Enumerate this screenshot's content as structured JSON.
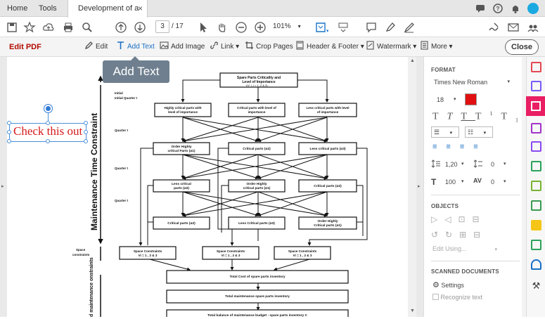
{
  "tabs": {
    "home": "Home",
    "tools": "Tools",
    "document": "Development of a s...",
    "close": "×"
  },
  "toolbar": {
    "page_current": "3",
    "page_total": "/ 17",
    "zoom": "101%"
  },
  "editbar": {
    "title": "Edit PDF",
    "edit": "Edit",
    "add_text": "Add Text",
    "add_image": "Add Image",
    "link": "Link ▾",
    "crop_pages": "Crop Pages",
    "header_footer": "Header & Footer ▾",
    "watermark": "Watermark ▾",
    "more": "More ▾",
    "close": "Close"
  },
  "tooltip": "Add Text",
  "canvas": {
    "added_text": "Check this out"
  },
  "panel": {
    "format_header": "FORMAT",
    "font_family": "Times New Roman",
    "font_size": "18",
    "font_color": "#e01010",
    "line_spacing": "1,20",
    "para_spacing": "0",
    "scale": "100",
    "char_spacing": "0",
    "objects_header": "OBJECTS",
    "edit_using": "Edit Using...",
    "scanned_header": "SCANNED DOCUMENTS",
    "settings": "Settings",
    "recognize": "Recognize text"
  },
  "diagram": {
    "top": "Spare Parts Criticality and Level of Importance",
    "top_sub": "(Ψ_i, i = 1, 2 & 3)",
    "vertical_title": "Maintenance Time Constraint",
    "quarter_labels": [
      "Initial Quarter t",
      "Quarter t",
      "Quarter t",
      "Quarter t"
    ],
    "row1": [
      "Highly critical parts with level of importance",
      "Critical parts with level of importance",
      "Less critical parts with level of importance"
    ],
    "row2": [
      "Order Highly critical Parts (α1)",
      "Critical parts (α2)",
      "Less critical parts (α3)"
    ],
    "row3": [
      "Less critical parts (α3)",
      "Order Highly critical parts (α1)",
      "Critical parts (α2)"
    ],
    "row4": [
      "Critical parts (α2)",
      "Less Critical parts (α3)",
      "Order Highly Critical parts (α1)"
    ],
    "space_label": "Space constraints",
    "space_boxes": [
      "Space Constraints Vi = 1 , 2 & 3",
      "Space Constraints Vi = 1 , 2 & 3",
      "Space Constraints Vi = 1 , 2 & 3"
    ],
    "total1": "Total Cost of spare parts inventory C0",
    "total2": "Total maintenance spare parts inventory C1",
    "total3": "Total balance of maintenance budget - spare parts inventory C",
    "bottom_vertical": "d maintenance onstraints"
  }
}
